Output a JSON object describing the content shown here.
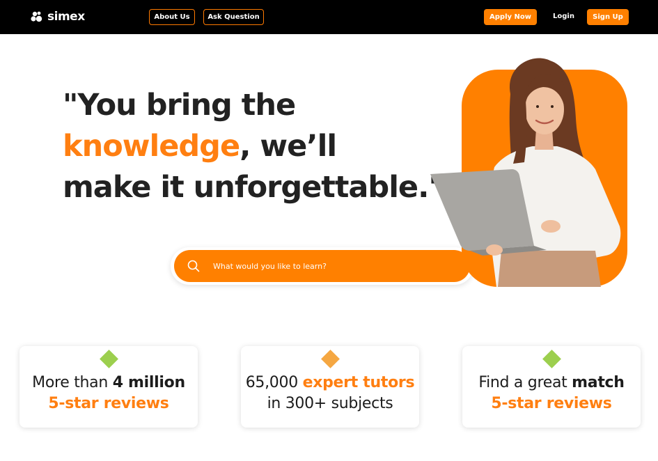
{
  "brand": {
    "name": "simex"
  },
  "nav": {
    "about": "About Us",
    "ask": "Ask Question",
    "apply": "Apply Now",
    "login": "Login",
    "signup": "Sign Up"
  },
  "hero": {
    "line1": "\"You bring the",
    "line2_accent": "knowledge",
    "line2_rest": ", we’ll",
    "line3": "make it unforgettable.\""
  },
  "search": {
    "placeholder": "What would you like to learn?",
    "icon": "search-icon"
  },
  "cards": [
    {
      "pre": "More than ",
      "bold": "4 million",
      "line2": "5-star reviews",
      "icon": "diamond-icon",
      "color": "#9ccf4e"
    },
    {
      "pre": "65,000 ",
      "accent": "expert tutors",
      "line2": "in 300+ subjects",
      "icon": "diamond-icon",
      "color": "#f5a742"
    },
    {
      "pre": "Find a great ",
      "bold": "match",
      "line2": "5-star reviews",
      "icon": "diamond-icon",
      "color": "#9ccf4e"
    }
  ],
  "colors": {
    "accent": "#ff8000",
    "navbar": "#000000",
    "green": "#9ccf4e"
  }
}
